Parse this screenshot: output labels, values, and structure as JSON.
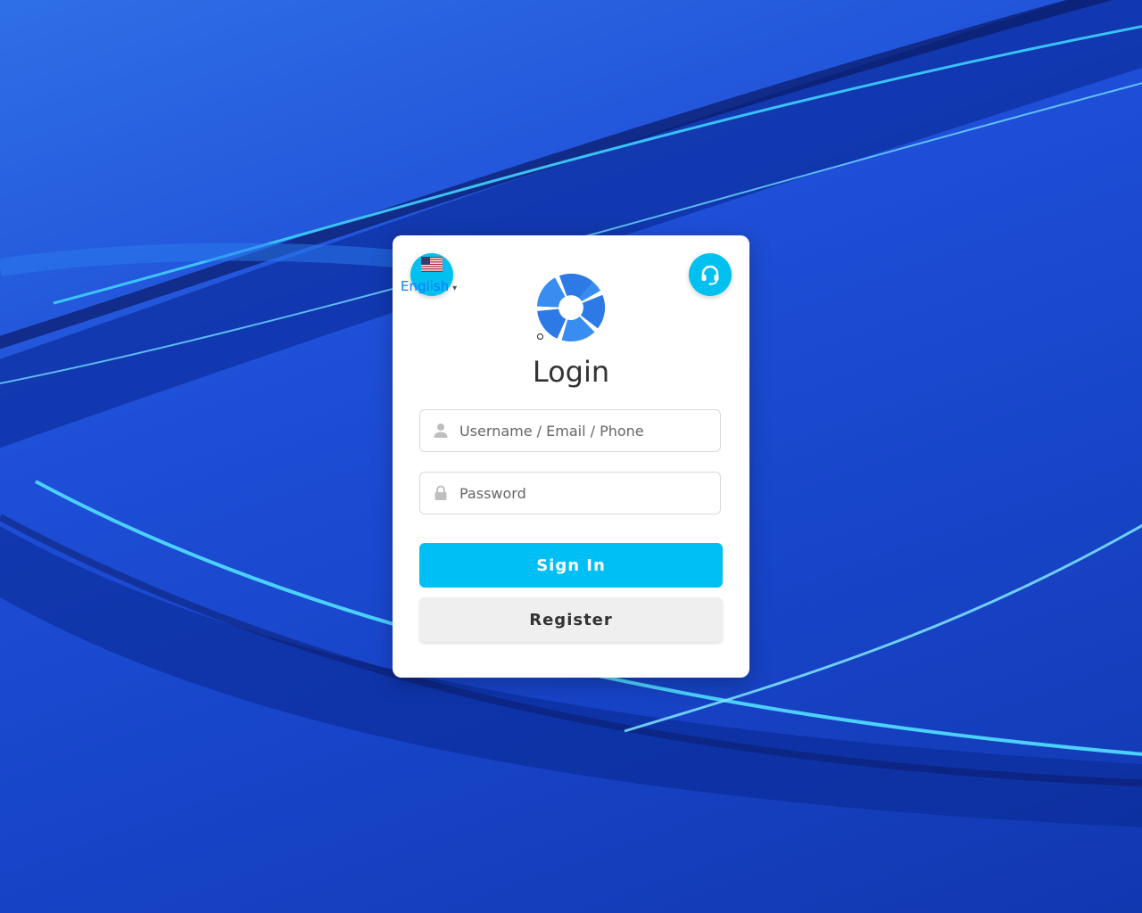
{
  "language": {
    "label": "English",
    "flag_icon": "us-flag-icon"
  },
  "support": {
    "icon": "headset-icon"
  },
  "login": {
    "title": "Login",
    "username_placeholder": "Username / Email / Phone",
    "password_placeholder": "Password",
    "signin_label": "Sign In",
    "register_label": "Register"
  },
  "colors": {
    "accent": "#00bff5",
    "link": "#1677ff"
  }
}
